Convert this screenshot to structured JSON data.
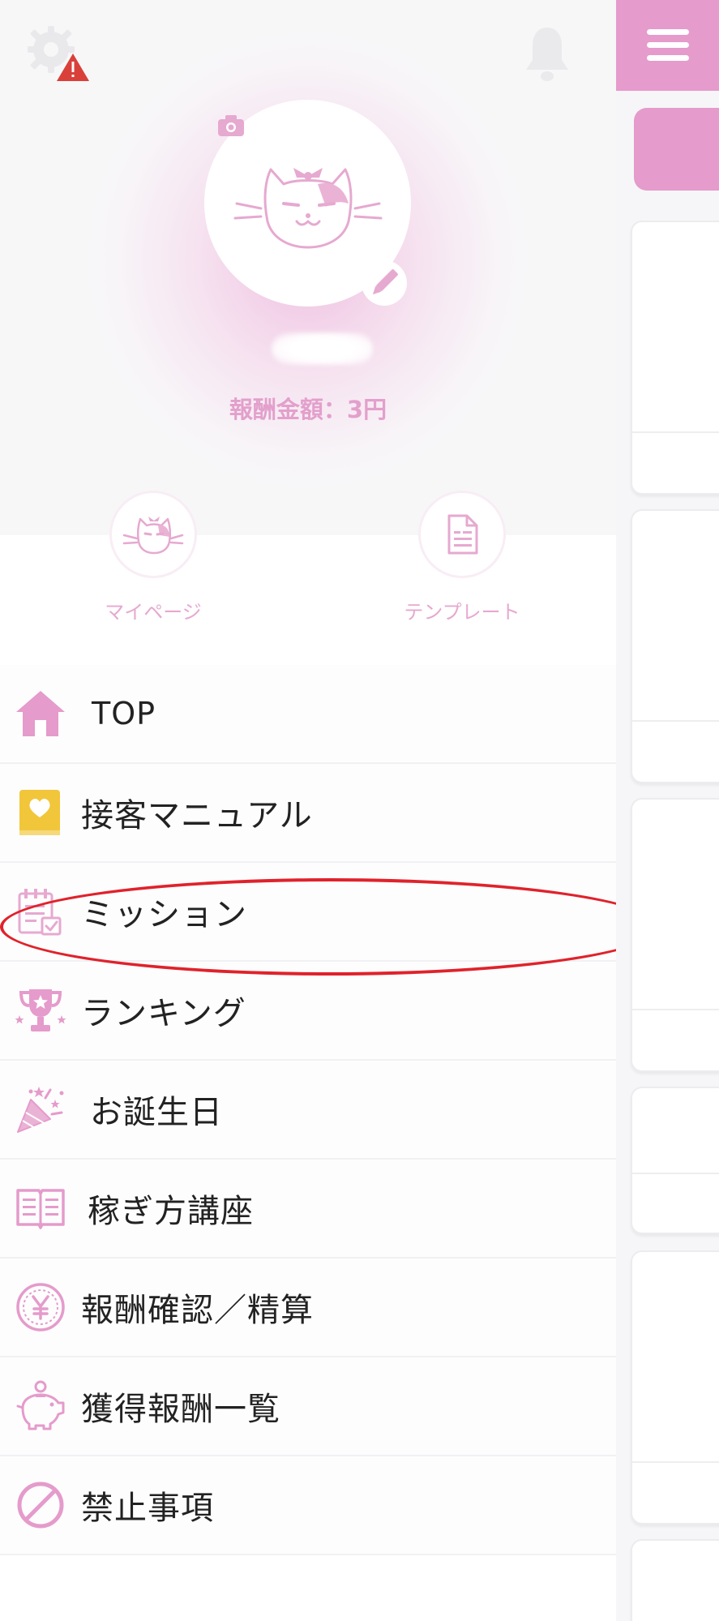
{
  "header": {
    "settings_icon": "gear-with-warning-icon",
    "notification_icon": "bell-icon",
    "menu_icon": "hamburger-icon"
  },
  "profile": {
    "avatar": "cat-avatar",
    "reward_label": "報酬金額：3円"
  },
  "quick_links": [
    {
      "label": "マイページ",
      "icon": "cat-face-icon"
    },
    {
      "label": "テンプレート",
      "icon": "document-icon"
    }
  ],
  "menu": {
    "items": [
      {
        "label": "TOP",
        "icon": "home-icon"
      },
      {
        "label": "接客マニュアル",
        "icon": "heart-book-icon"
      },
      {
        "label": "ミッション",
        "icon": "mission-checklist-icon"
      },
      {
        "label": "ランキング",
        "icon": "trophy-icon"
      },
      {
        "label": "お誕生日",
        "icon": "party-popper-icon"
      },
      {
        "label": "稼ぎ方講座",
        "icon": "open-book-icon"
      },
      {
        "label": "報酬確認／精算",
        "icon": "yen-coin-icon"
      },
      {
        "label": "獲得報酬一覧",
        "icon": "piggy-bank-icon"
      },
      {
        "label": "禁止事項",
        "icon": "prohibited-icon"
      }
    ],
    "highlighted_item": "ミッション"
  },
  "colors": {
    "accent_pink": "#e59bcb",
    "label_pink": "#e3a0cc",
    "highlight_red": "#e0222b",
    "warning_red": "#d9403a"
  }
}
